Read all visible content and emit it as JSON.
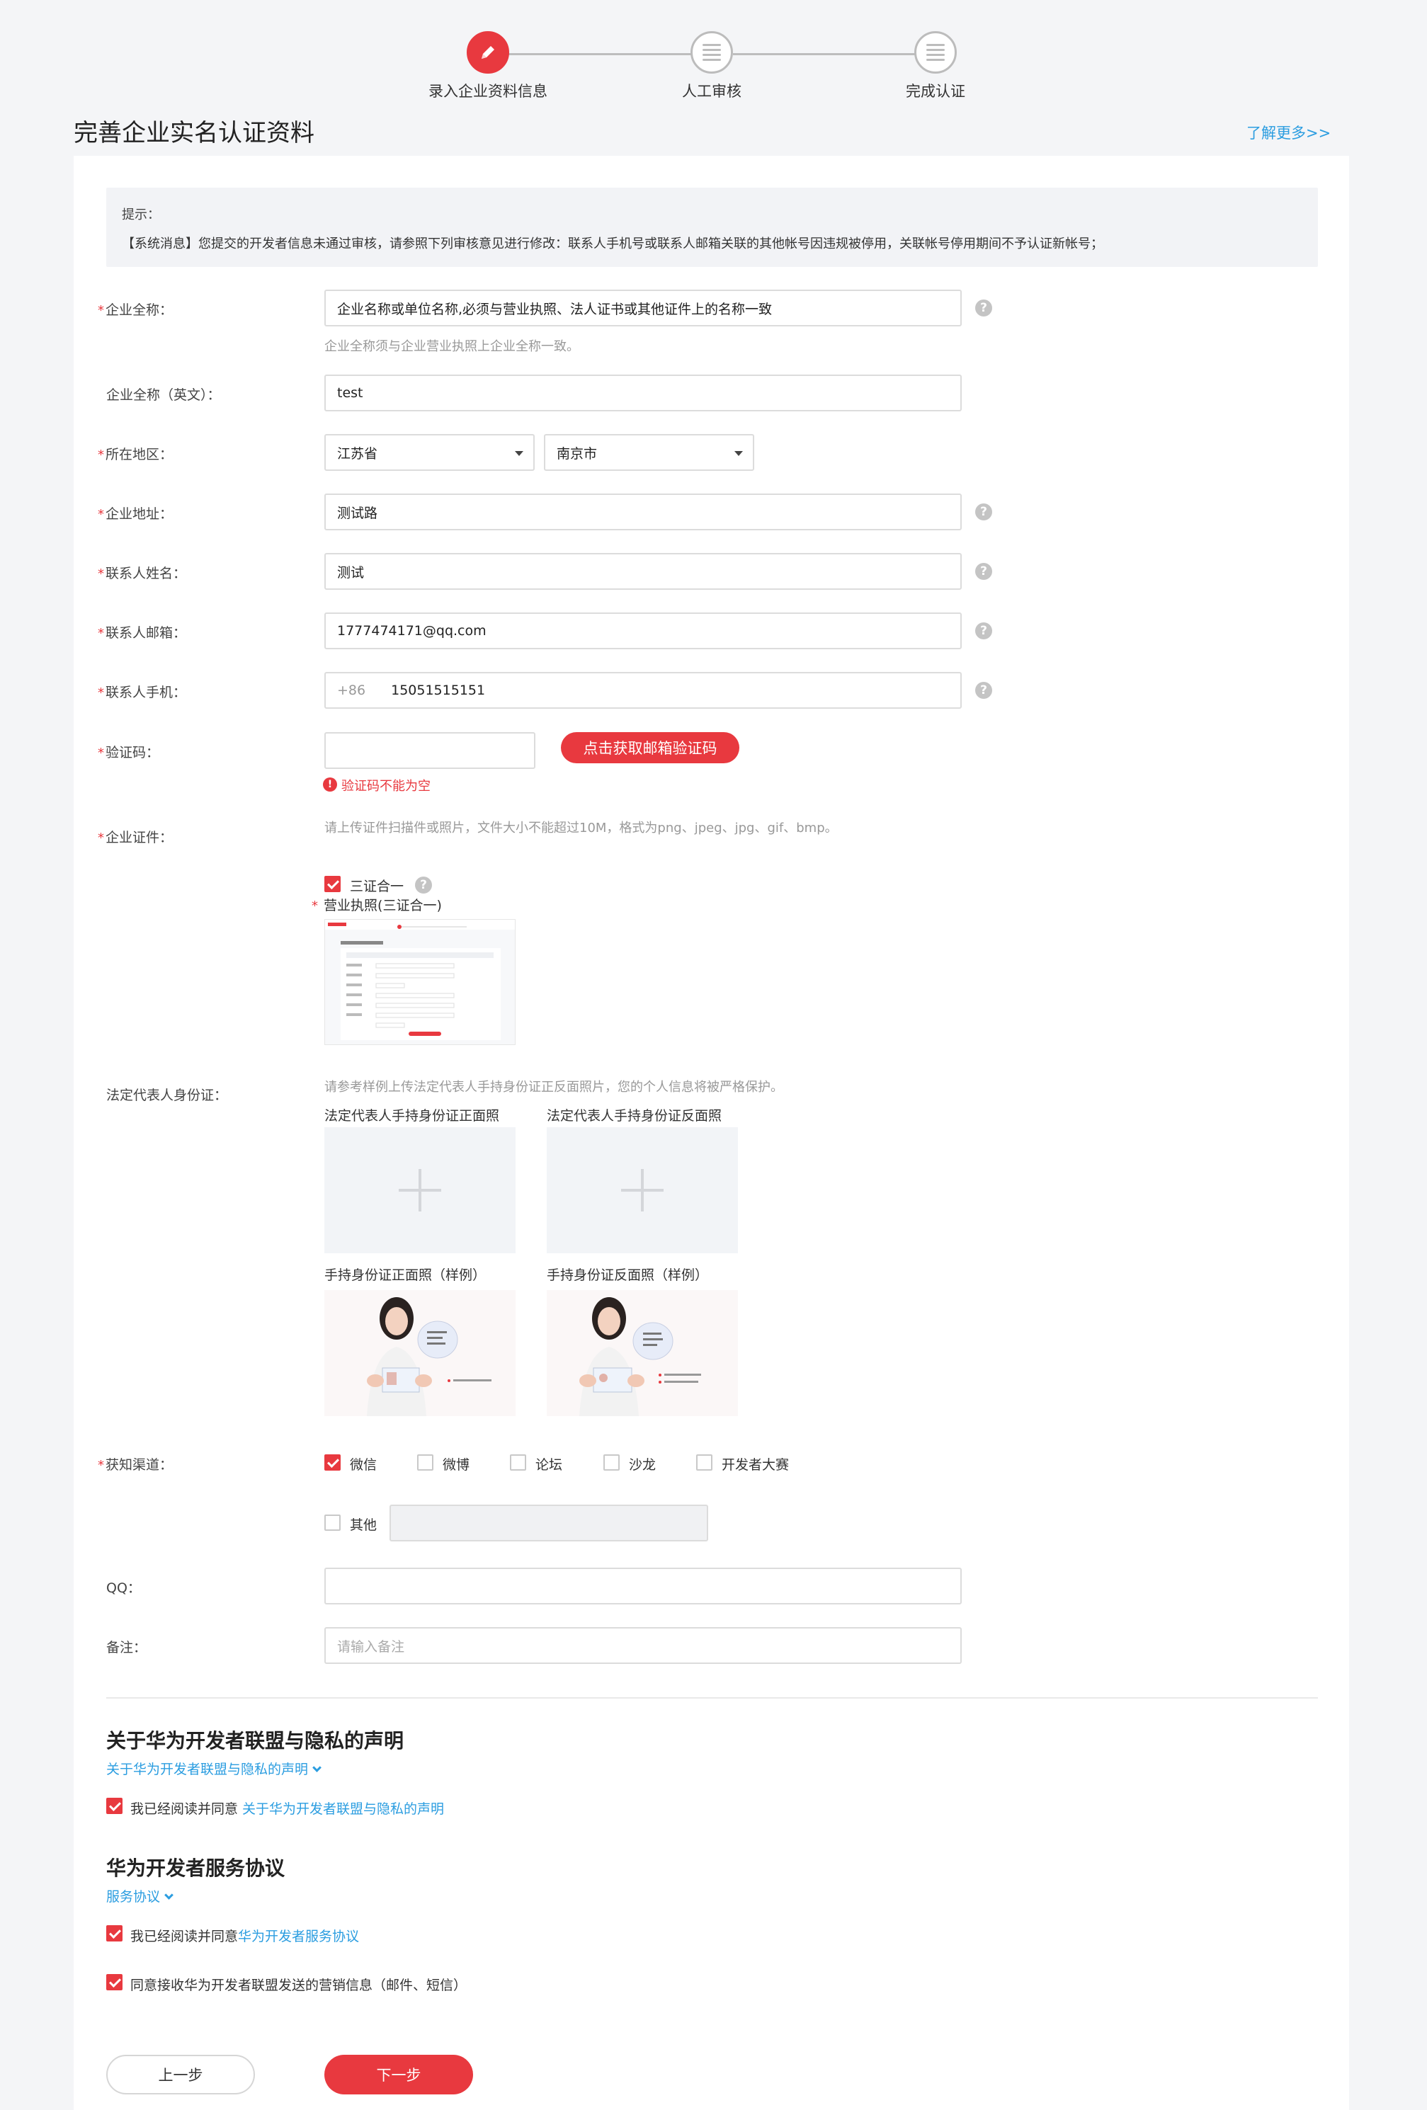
{
  "steps": [
    {
      "label": "录入企业资料信息",
      "icon": "pencil-icon",
      "active": true
    },
    {
      "label": "人工审核",
      "icon": "list-icon",
      "active": false
    },
    {
      "label": "完成认证",
      "icon": "list-icon",
      "active": false
    }
  ],
  "page_title": "完善企业实名认证资料",
  "learn_more": "了解更多>>",
  "tip": {
    "title": "提示：",
    "text": "【系统消息】您提交的开发者信息未通过审核，请参照下列审核意见进行修改：联系人手机号或联系人邮箱关联的其他帐号因违规被停用，关联帐号停用期间不予认证新帐号；"
  },
  "required_mark": "*",
  "help_mark": "?",
  "form": {
    "company_name": {
      "label": "企业全称：",
      "value": "企业名称或单位名称,必须与营业执照、法人证书或其他证件上的名称一致",
      "hint": "企业全称须与企业营业执照上企业全称一致。"
    },
    "company_name_en": {
      "label": "企业全称（英文）：",
      "value": "test"
    },
    "region": {
      "label": "所在地区：",
      "province": "江苏省",
      "city": "南京市"
    },
    "address": {
      "label": "企业地址：",
      "value": "测试路"
    },
    "contact_name": {
      "label": "联系人姓名：",
      "value": "测试"
    },
    "contact_email": {
      "label": "联系人邮箱：",
      "value": "1777474171@qq.com"
    },
    "contact_phone": {
      "label": "联系人手机：",
      "prefix": "+86",
      "value": "15051515151"
    },
    "verify_code": {
      "label": "验证码：",
      "value": "",
      "button": "点击获取邮箱验证码",
      "error": "验证码不能为空"
    },
    "certificate": {
      "label": "企业证件：",
      "hint": "请上传证件扫描件或照片，文件大小不能超过10M，格式为png、jpeg、jpg、gif、bmp。",
      "three_in_one": "三证合一",
      "license_label": "营业执照(三证合一)"
    },
    "legal_id": {
      "label": "法定代表人身份证：",
      "hint": "请参考样例上传法定代表人手持身份证正反面照片，您的个人信息将被严格保护。",
      "front_label": "法定代表人手持身份证正面照",
      "back_label": "法定代表人手持身份证反面照",
      "front_sample": "手持身份证正面照（样例）",
      "back_sample": "手持身份证反面照（样例）"
    },
    "channel": {
      "label": "获知渠道：",
      "options": [
        {
          "label": "微信",
          "checked": true
        },
        {
          "label": "微博",
          "checked": false
        },
        {
          "label": "论坛",
          "checked": false
        },
        {
          "label": "沙龙",
          "checked": false
        },
        {
          "label": "开发者大赛",
          "checked": false
        },
        {
          "label": "其他",
          "checked": false
        }
      ],
      "other_value": ""
    },
    "qq": {
      "label": "QQ：",
      "value": ""
    },
    "remark": {
      "label": "备注：",
      "placeholder": "请输入备注"
    }
  },
  "privacy": {
    "title": "关于华为开发者联盟与隐私的声明",
    "link": "关于华为开发者联盟与隐私的声明",
    "agree_prefix": "我已经阅读并同意 ",
    "agree_link": "关于华为开发者联盟与隐私的声明",
    "checked": true
  },
  "service": {
    "title": "华为开发者服务协议",
    "link": "服务协议",
    "agree_prefix": "我已经阅读并同意",
    "agree_link": "华为开发者服务协议",
    "checked": true,
    "marketing": "同意接收华为开发者联盟发送的营销信息（邮件、短信）",
    "marketing_checked": true
  },
  "buttons": {
    "prev": "上一步",
    "next": "下一步"
  },
  "colors": {
    "accent": "#e8393f",
    "link": "#2b9de0",
    "page_bg": "#f4f5f7"
  }
}
